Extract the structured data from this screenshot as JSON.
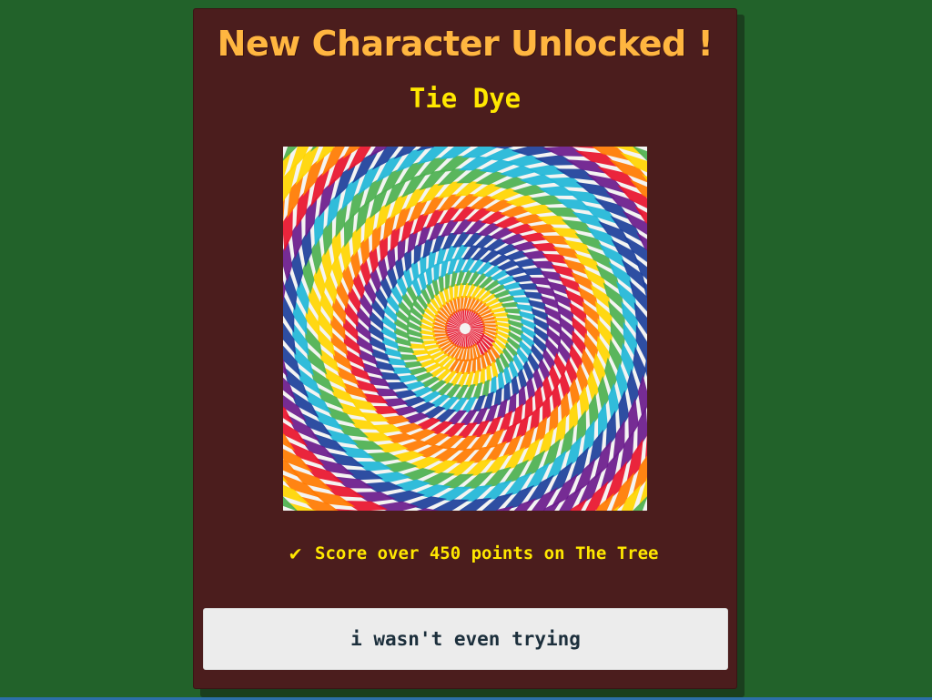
{
  "modal": {
    "title": "New Character Unlocked !",
    "character_name": "Tie Dye",
    "portrait_icon": "tie-dye-spiral",
    "requirement": {
      "check_glyph": "✔",
      "text": "Score over 450 points on The Tree",
      "completed": true
    },
    "dismiss_label": "i wasn't even trying"
  },
  "colors": {
    "background": "#22622a",
    "modal_bg": "#4b1d1d",
    "title": "#ffb640",
    "accent_text": "#ffe800",
    "button_bg": "#ececec",
    "button_text": "#1c2f3c"
  }
}
